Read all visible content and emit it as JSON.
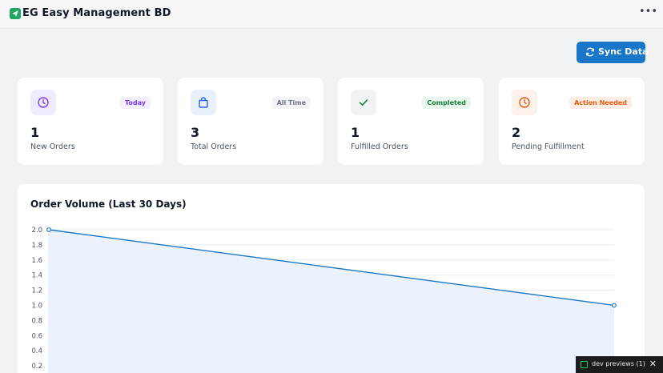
{
  "app": {
    "title": "EG Easy Management BD",
    "logo_icon": "send-icon",
    "menu_icon": "more-horizontal-icon"
  },
  "actions": {
    "sync_label": "Sync Data",
    "sync_icon": "refresh-icon",
    "accent": "#1976c8"
  },
  "cards": [
    {
      "count": "1",
      "label": "New Orders",
      "badge": "Today",
      "icon": "clock-icon",
      "color": "#7c3aed"
    },
    {
      "count": "3",
      "label": "Total Orders",
      "badge": "All Time",
      "icon": "shopping-bag-icon",
      "color": "#2563eb"
    },
    {
      "count": "1",
      "label": "Fulfilled Orders",
      "badge": "Completed",
      "icon": "check-icon",
      "color": "#15803d"
    },
    {
      "count": "2",
      "label": "Pending Fulfillment",
      "badge": "Action Needed",
      "icon": "clock-icon",
      "color": "#ea580c"
    }
  ],
  "chart": {
    "title": "Order Volume (Last 30 Days)"
  },
  "chart_data": {
    "type": "line",
    "title": "Order Volume (Last 30 Days)",
    "xlabel": "",
    "ylabel": "",
    "y_ticks": [
      "2.0",
      "1.8",
      "1.6",
      "1.4",
      "1.2",
      "1.0",
      "0.8",
      "0.6",
      "0.4",
      "0.2"
    ],
    "ylim": [
      0,
      2.0
    ],
    "series": [
      {
        "values": [
          2,
          1
        ],
        "color": "#1976c8",
        "fill": "#e8f0fa"
      }
    ],
    "grid": true
  },
  "devbar": {
    "label": "dev previews",
    "count": "(1)"
  }
}
